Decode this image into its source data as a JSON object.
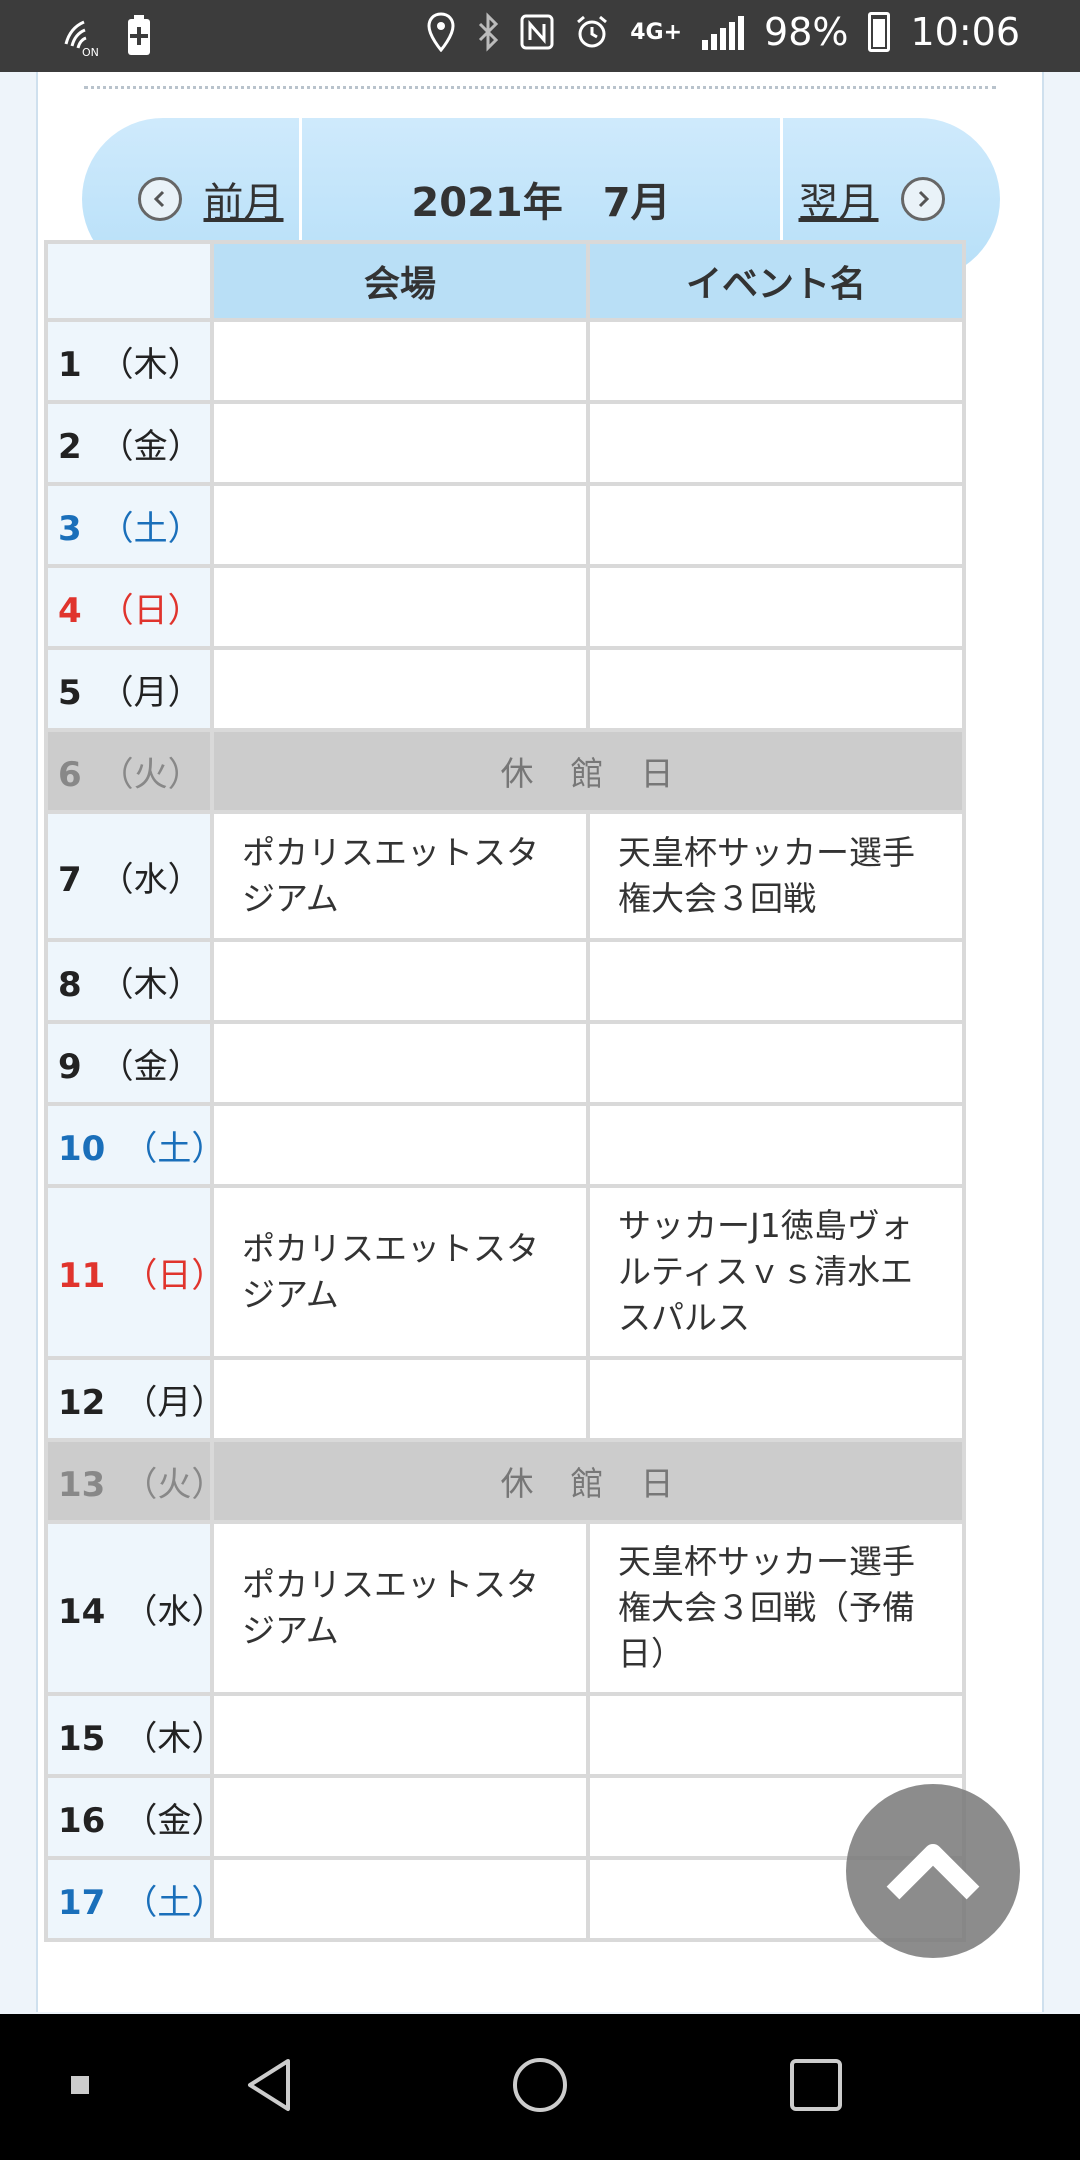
{
  "status_bar": {
    "battery_percent": "98%",
    "time": "10:06",
    "network_label": "4G+",
    "icons": [
      "wifi-calling-icon",
      "battery-saver-icon",
      "location-icon",
      "bluetooth-icon",
      "nfc-icon",
      "alarm-icon",
      "network-4g-icon",
      "signal-icon",
      "battery-icon"
    ]
  },
  "month_nav": {
    "prev_label": "前月",
    "title": "2021年　7月",
    "next_label": "翌月"
  },
  "table": {
    "headers": [
      "",
      "会場",
      "イベント名"
    ],
    "closed_label": "休　館　日",
    "rows": [
      {
        "day": "1",
        "weekday": "（木）",
        "type": "weekday",
        "venue": "",
        "event": ""
      },
      {
        "day": "2",
        "weekday": "（金）",
        "type": "weekday",
        "venue": "",
        "event": ""
      },
      {
        "day": "3",
        "weekday": "（土）",
        "type": "sat",
        "venue": "",
        "event": ""
      },
      {
        "day": "4",
        "weekday": "（日）",
        "type": "sun",
        "venue": "",
        "event": ""
      },
      {
        "day": "5",
        "weekday": "（月）",
        "type": "weekday",
        "venue": "",
        "event": ""
      },
      {
        "day": "6",
        "weekday": "（火）",
        "type": "closed",
        "venue": "",
        "event": ""
      },
      {
        "day": "7",
        "weekday": "（水）",
        "type": "weekday",
        "venue": "ポカリスエットスタジアム",
        "event": "天皇杯サッカー選手権大会３回戦"
      },
      {
        "day": "8",
        "weekday": "（木）",
        "type": "weekday",
        "venue": "",
        "event": ""
      },
      {
        "day": "9",
        "weekday": "（金）",
        "type": "weekday",
        "venue": "",
        "event": ""
      },
      {
        "day": "10",
        "weekday": "（土）",
        "type": "sat",
        "venue": "",
        "event": ""
      },
      {
        "day": "11",
        "weekday": "（日）",
        "type": "sun",
        "venue": "ポカリスエットスタジアム",
        "event": "サッカーJ1徳島ヴォルティスｖｓ清水エスパルス"
      },
      {
        "day": "12",
        "weekday": "（月）",
        "type": "weekday",
        "venue": "",
        "event": ""
      },
      {
        "day": "13",
        "weekday": "（火）",
        "type": "closed",
        "venue": "",
        "event": ""
      },
      {
        "day": "14",
        "weekday": "（水）",
        "type": "weekday",
        "venue": "ポカリスエットスタジアム",
        "event": "天皇杯サッカー選手権大会３回戦（予備日）"
      },
      {
        "day": "15",
        "weekday": "（木）",
        "type": "weekday",
        "venue": "",
        "event": ""
      },
      {
        "day": "16",
        "weekday": "（金）",
        "type": "weekday",
        "venue": "",
        "event": ""
      },
      {
        "day": "17",
        "weekday": "（土）",
        "type": "sat",
        "venue": "",
        "event": ""
      }
    ]
  },
  "colors": {
    "saturday": "#1a6fba",
    "sunday": "#e0342d",
    "header_bg": "#b9dff6",
    "closed_bg": "#cccccc"
  }
}
